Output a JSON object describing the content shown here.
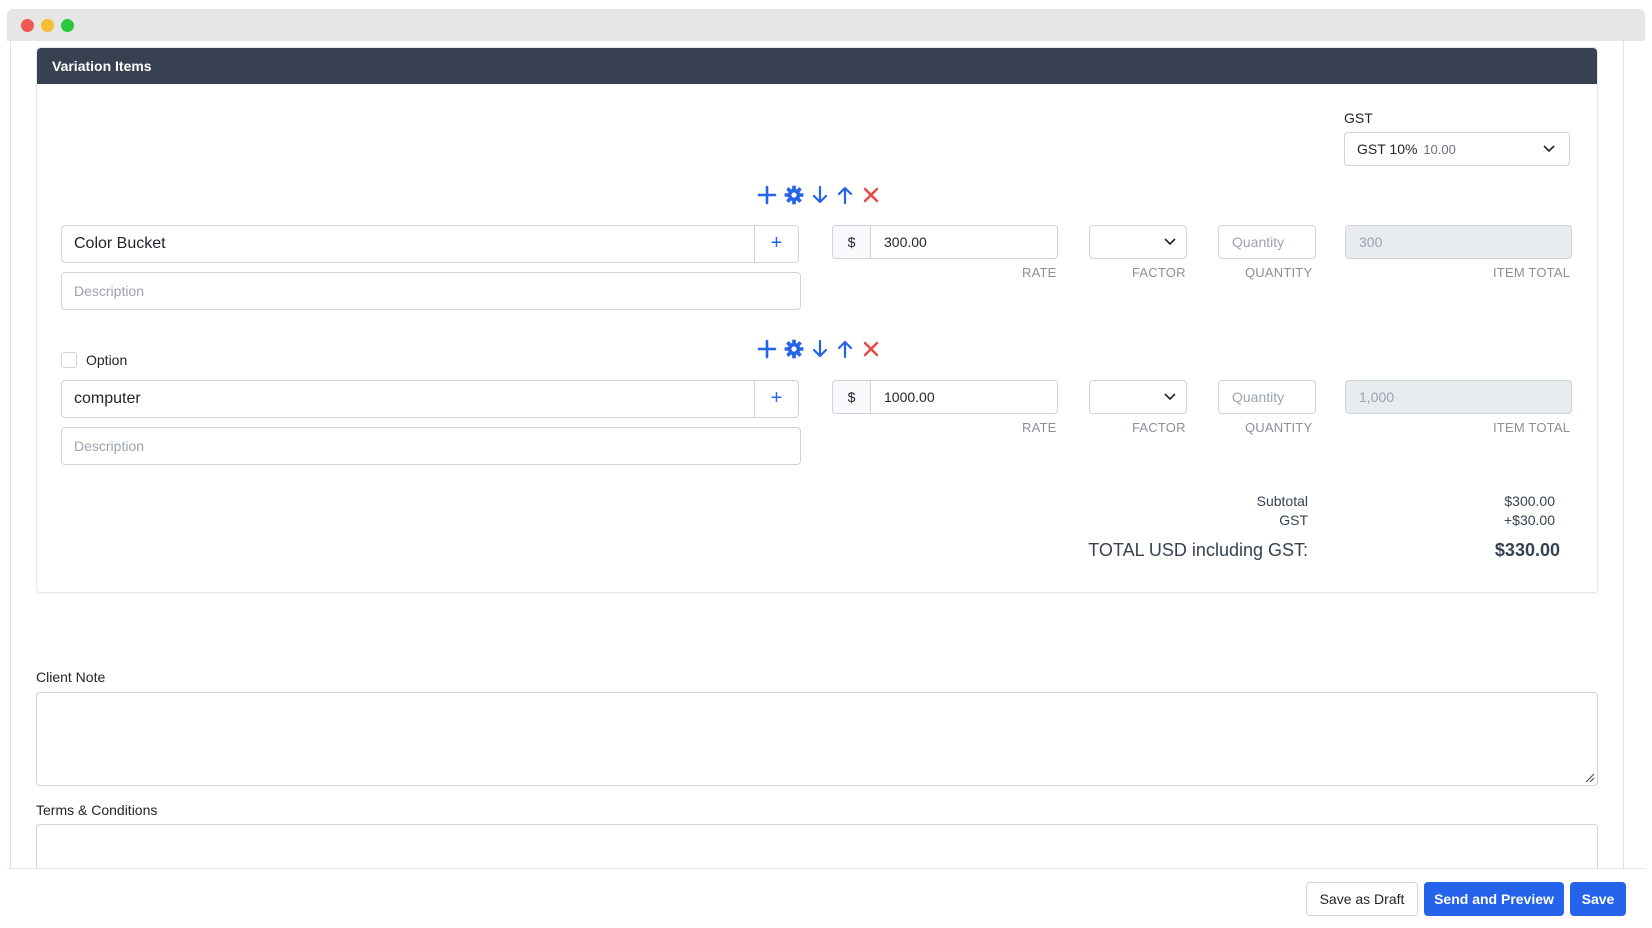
{
  "card": {
    "title": "Variation Items"
  },
  "gst": {
    "label": "GST",
    "selected": "GST 10%",
    "selected_sub": "10.00"
  },
  "items": [
    {
      "name": "Color Bucket",
      "add_symbol": "+",
      "description_placeholder": "Description",
      "currency": "$",
      "rate": "300.00",
      "quantity_placeholder": "Quantity",
      "item_total": "300",
      "labels": {
        "rate": "RATE",
        "factor": "FACTOR",
        "quantity": "QUANTITY",
        "item_total": "ITEM TOTAL"
      }
    },
    {
      "option_label": "Option",
      "name": "computer",
      "add_symbol": "+",
      "description_placeholder": "Description",
      "currency": "$",
      "rate": "1000.00",
      "quantity_placeholder": "Quantity",
      "item_total": "1,000",
      "labels": {
        "rate": "RATE",
        "factor": "FACTOR",
        "quantity": "QUANTITY",
        "item_total": "ITEM TOTAL"
      }
    }
  ],
  "summary": {
    "subtotal_label": "Subtotal",
    "subtotal_value": "$300.00",
    "gst_label": "GST",
    "gst_value": "+$30.00",
    "total_label": "TOTAL USD including GST:",
    "total_value": "$330.00"
  },
  "client_note": {
    "label": "Client Note"
  },
  "terms": {
    "label": "Terms & Conditions"
  },
  "footer": {
    "save_draft": "Save as Draft",
    "send_preview": "Send and Preview",
    "save": "Save"
  },
  "colors": {
    "primary": "#2563eb",
    "header": "#374151",
    "danger": "#ef4444"
  },
  "icons": [
    "plus-icon",
    "gear-icon",
    "arrow-down-icon",
    "arrow-up-icon",
    "close-icon",
    "chevron-down-icon"
  ]
}
